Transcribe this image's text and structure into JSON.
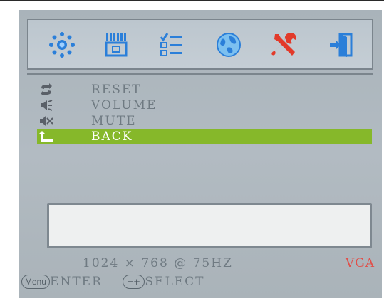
{
  "osd": {
    "tabs": [
      {
        "icon": "brightness-icon",
        "label": ""
      },
      {
        "icon": "display-image-icon",
        "label": ""
      },
      {
        "icon": "checklist-icon",
        "label": ""
      },
      {
        "icon": "globe-icon",
        "label": ""
      },
      {
        "icon": "tools-icon",
        "label": ""
      },
      {
        "icon": "exit-icon",
        "label": ""
      }
    ],
    "active_tab_index": 4,
    "menu_items": [
      {
        "icon": "reset-icon",
        "label": "RESET"
      },
      {
        "icon": "volume-icon",
        "label": "VOLUME"
      },
      {
        "icon": "mute-icon",
        "label": "MUTE"
      },
      {
        "icon": "back-icon",
        "label": "BACK"
      }
    ],
    "selected_item_index": 3,
    "status": {
      "resolution": "1024 × 768 @ 75HZ",
      "input": "VGA"
    },
    "hints": {
      "menu_key": "Menu",
      "menu_action": "ENTER",
      "adjust_key": "−+",
      "adjust_action": "SELECT"
    },
    "colors": {
      "background": "#b1bac1",
      "selection": "#86b82a",
      "text": "#6f7a82",
      "input_label": "#e0504a",
      "icon_blue": "#2b7fd9",
      "icon_red": "#e23a2a"
    }
  }
}
